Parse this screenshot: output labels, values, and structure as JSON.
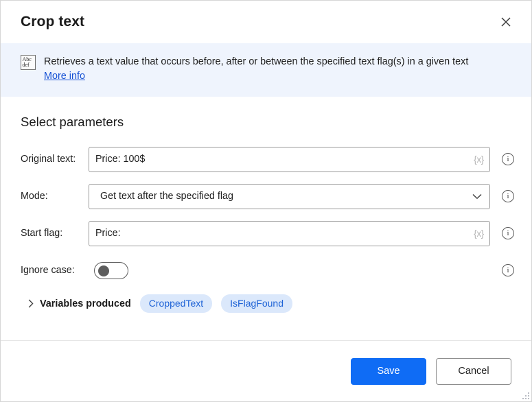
{
  "window": {
    "title": "Crop text",
    "close_icon": "close-icon",
    "resize_grip": "resize-grip"
  },
  "banner": {
    "icon_line1": "Abc",
    "icon_line2": "def",
    "description": "Retrieves a text value that occurs before, after or between the specified text flag(s) in a given text",
    "link_label": "More info",
    "background": "#eff4fd",
    "link_color": "#1450d4"
  },
  "main": {
    "section_title": "Select parameters",
    "fields": [
      {
        "label": "Original text:",
        "value": "Price: 100$",
        "kind": "text",
        "var_glyph": "{x}",
        "info_icon": "info-icon"
      },
      {
        "label": "Mode:",
        "value": "Get text after the specified flag",
        "kind": "dropdown",
        "chevron_icon": "chevron-down-icon",
        "info_icon": "info-icon"
      },
      {
        "label": "Start flag:",
        "value": "Price:",
        "kind": "text",
        "var_glyph": "{x}",
        "info_icon": "info-icon"
      }
    ],
    "toggle": {
      "label": "Ignore case:",
      "state": "off",
      "info_icon": "info-icon"
    },
    "variables": {
      "chevron_icon": "chevron-right-icon",
      "title": "Variables produced",
      "pills": [
        "CroppedText",
        "IsFlagFound"
      ],
      "pill_background": "#dbe8fb",
      "pill_color": "#1d62d6"
    }
  },
  "footer": {
    "save_label": "Save",
    "cancel_label": "Cancel",
    "primary_color": "#0f6cf5"
  }
}
